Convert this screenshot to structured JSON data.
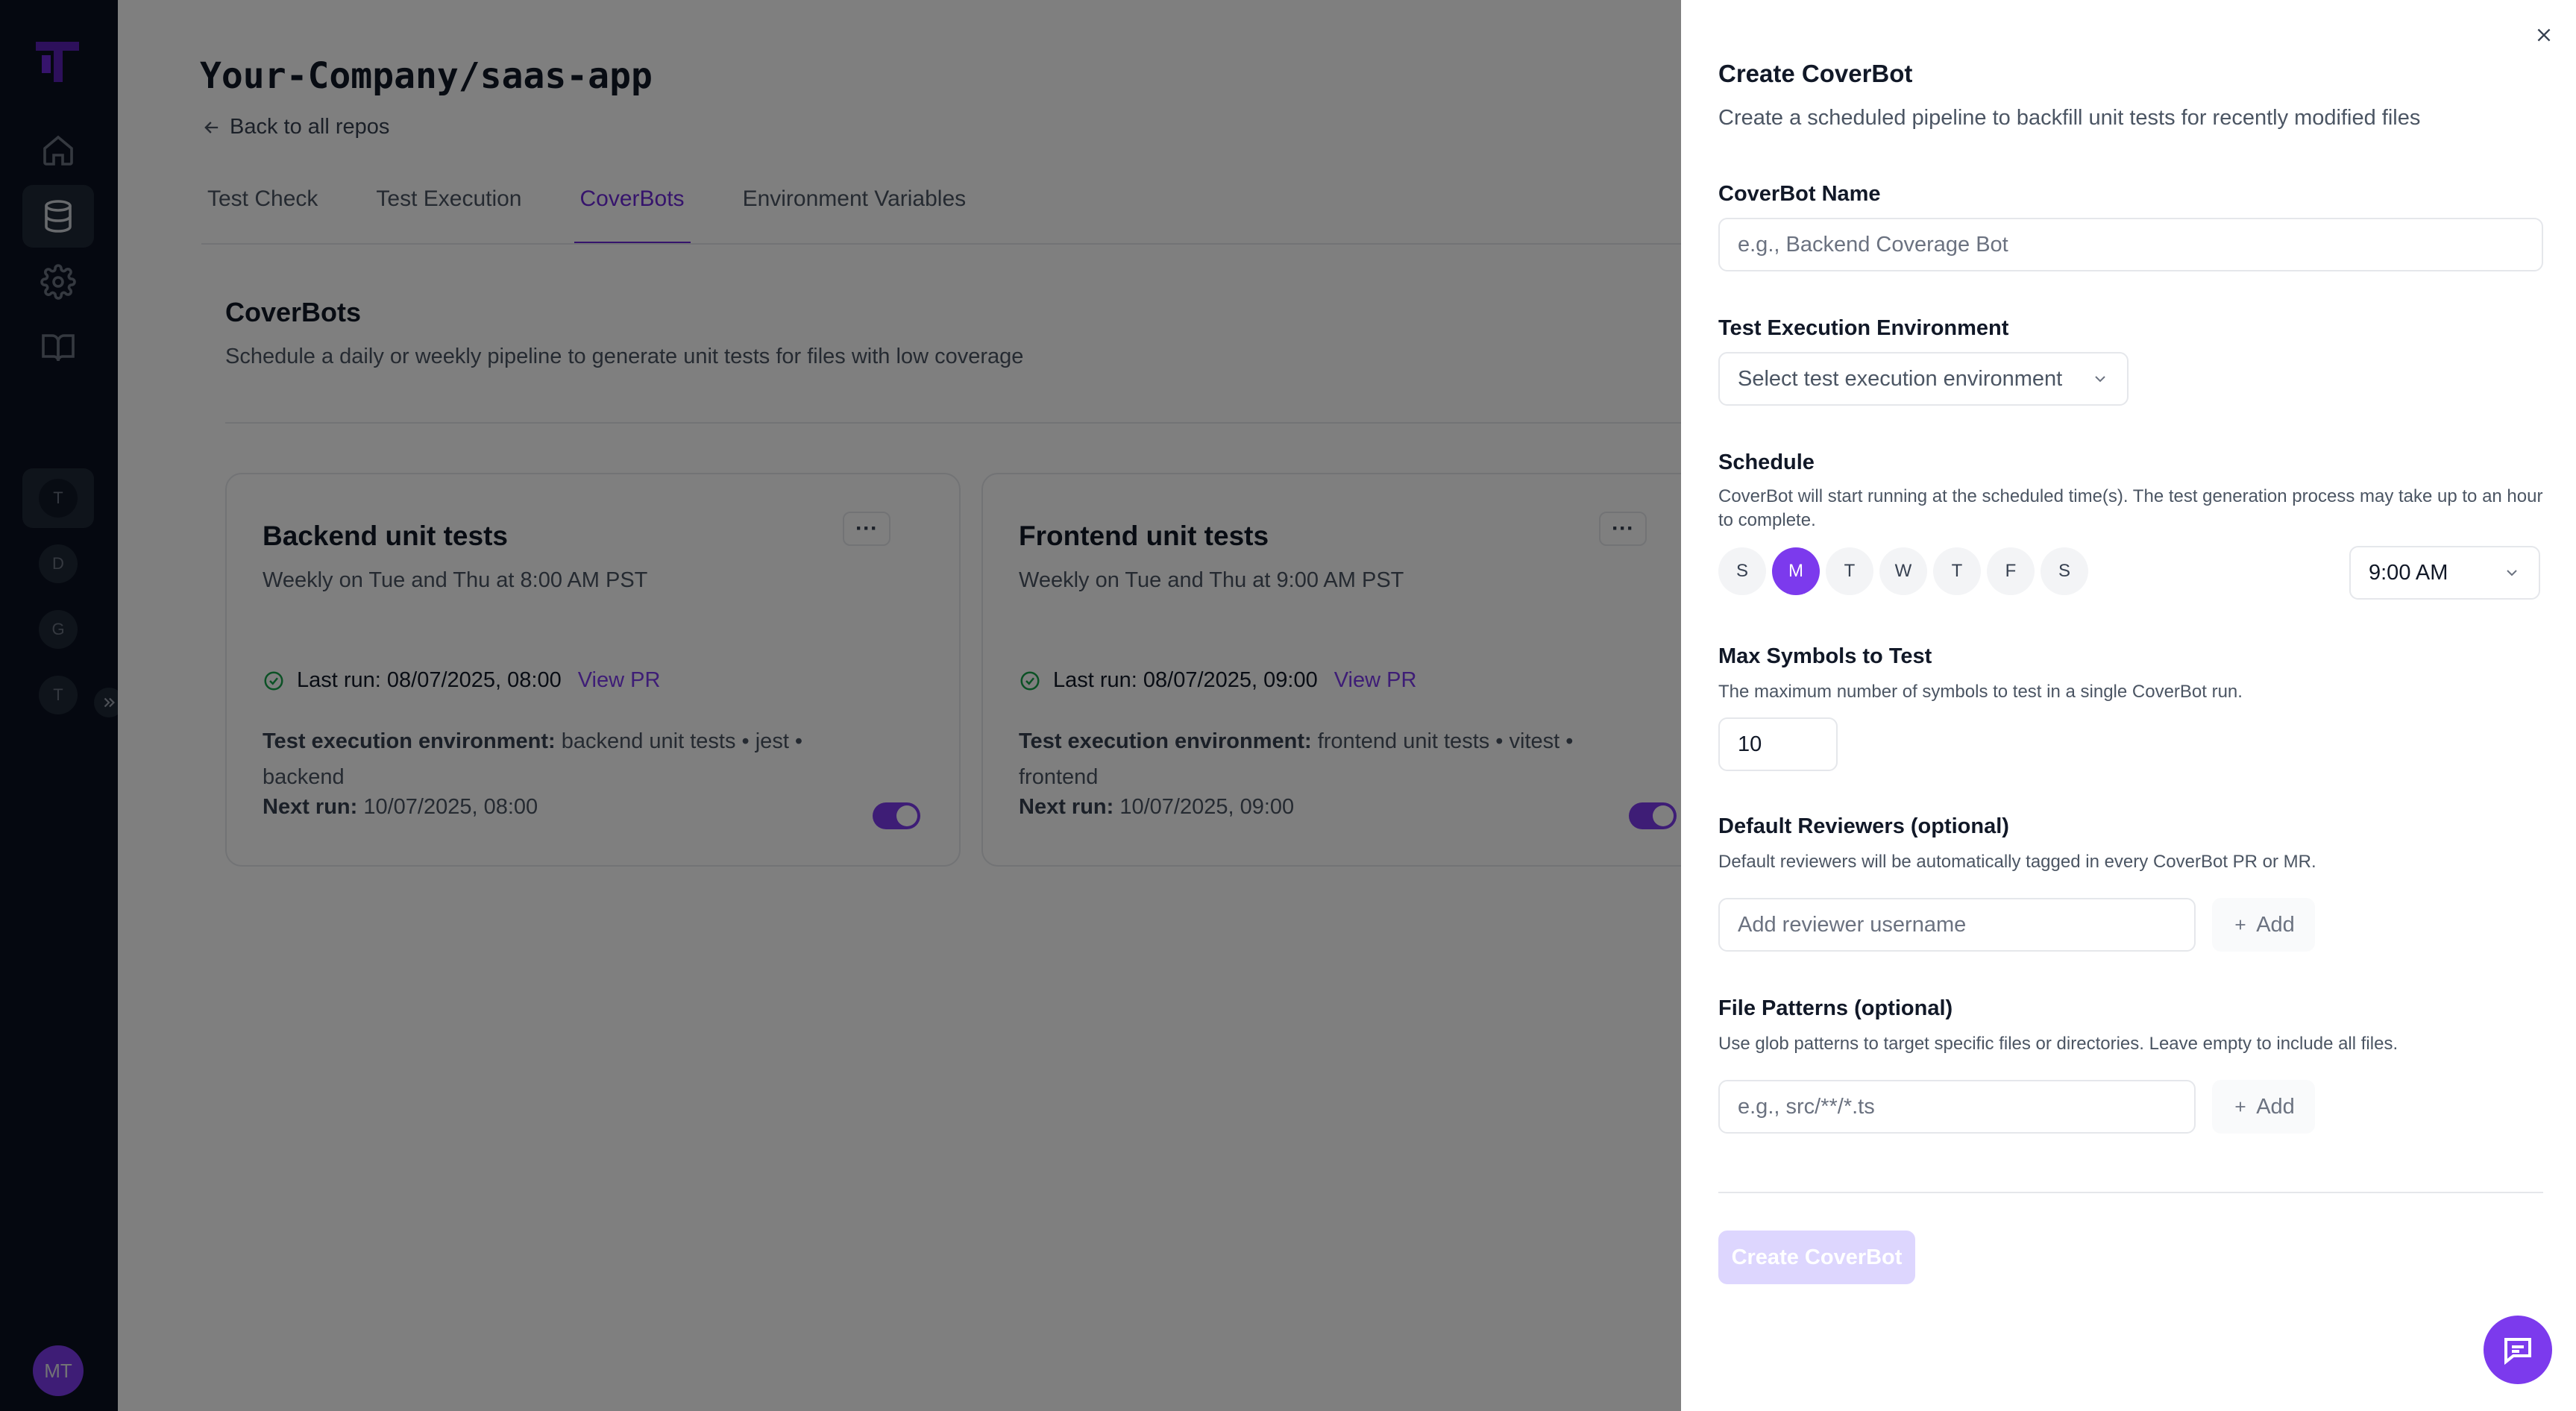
{
  "sidebar": {
    "avatar_initials": "MT",
    "workspaces": [
      "T",
      "D",
      "G",
      "T"
    ]
  },
  "header": {
    "repo_title": "Your-Company/saas-app",
    "back_link": "Back to all repos"
  },
  "tabs": [
    {
      "label": "Test Check"
    },
    {
      "label": "Test Execution"
    },
    {
      "label": "CoverBots"
    },
    {
      "label": "Environment Variables"
    }
  ],
  "section": {
    "title": "CoverBots",
    "description": "Schedule a daily or weekly pipeline to generate unit tests for files with low coverage"
  },
  "cards": [
    {
      "title": "Backend unit tests",
      "schedule": "Weekly on Tue and Thu at 8:00 AM PST",
      "last_run": "Last run: 08/07/2025, 08:00",
      "view_pr": "View PR",
      "env_label": "Test execution environment:",
      "env_value": "backend unit tests • jest • backend",
      "next_label": "Next run:",
      "next_value": "10/07/2025, 08:00",
      "enabled": true
    },
    {
      "title": "Frontend unit tests",
      "schedule": "Weekly on Tue and Thu at 9:00 AM PST",
      "last_run": "Last run: 08/07/2025, 09:00",
      "view_pr": "View PR",
      "env_label": "Test execution environment:",
      "env_value": "frontend unit tests • vitest • frontend",
      "next_label": "Next run:",
      "next_value": "10/07/2025, 09:00",
      "enabled": true
    }
  ],
  "drawer": {
    "title": "Create CoverBot",
    "description": "Create a scheduled pipeline to backfill unit tests for recently modified files",
    "name_label": "CoverBot Name",
    "name_placeholder": "e.g., Backend Coverage Bot",
    "env_label": "Test Execution Environment",
    "env_placeholder": "Select test execution environment",
    "schedule_label": "Schedule",
    "schedule_hint": "CoverBot will start running at the scheduled time(s). The test generation process may take up to an hour to complete.",
    "days": [
      {
        "label": "S",
        "selected": false
      },
      {
        "label": "M",
        "selected": true
      },
      {
        "label": "T",
        "selected": false
      },
      {
        "label": "W",
        "selected": false
      },
      {
        "label": "T",
        "selected": false
      },
      {
        "label": "F",
        "selected": false
      },
      {
        "label": "S",
        "selected": false
      }
    ],
    "time_value": "9:00 AM",
    "max_label": "Max Symbols to Test",
    "max_hint": "The maximum number of symbols to test in a single CoverBot run.",
    "max_value": "10",
    "reviewers_label": "Default Reviewers (optional)",
    "reviewers_hint": "Default reviewers will be automatically tagged in every CoverBot PR or MR.",
    "reviewers_placeholder": "Add reviewer username",
    "patterns_label": "File Patterns (optional)",
    "patterns_hint": "Use glob patterns to target specific files or directories. Leave empty to include all files.",
    "patterns_placeholder": "e.g., src/**/*.ts",
    "add_label": "Add",
    "create_label": "Create CoverBot"
  },
  "colors": {
    "accent": "#7c3aed",
    "rail": "#0b1120",
    "overlay": "rgba(0,0,0,0.5)"
  }
}
